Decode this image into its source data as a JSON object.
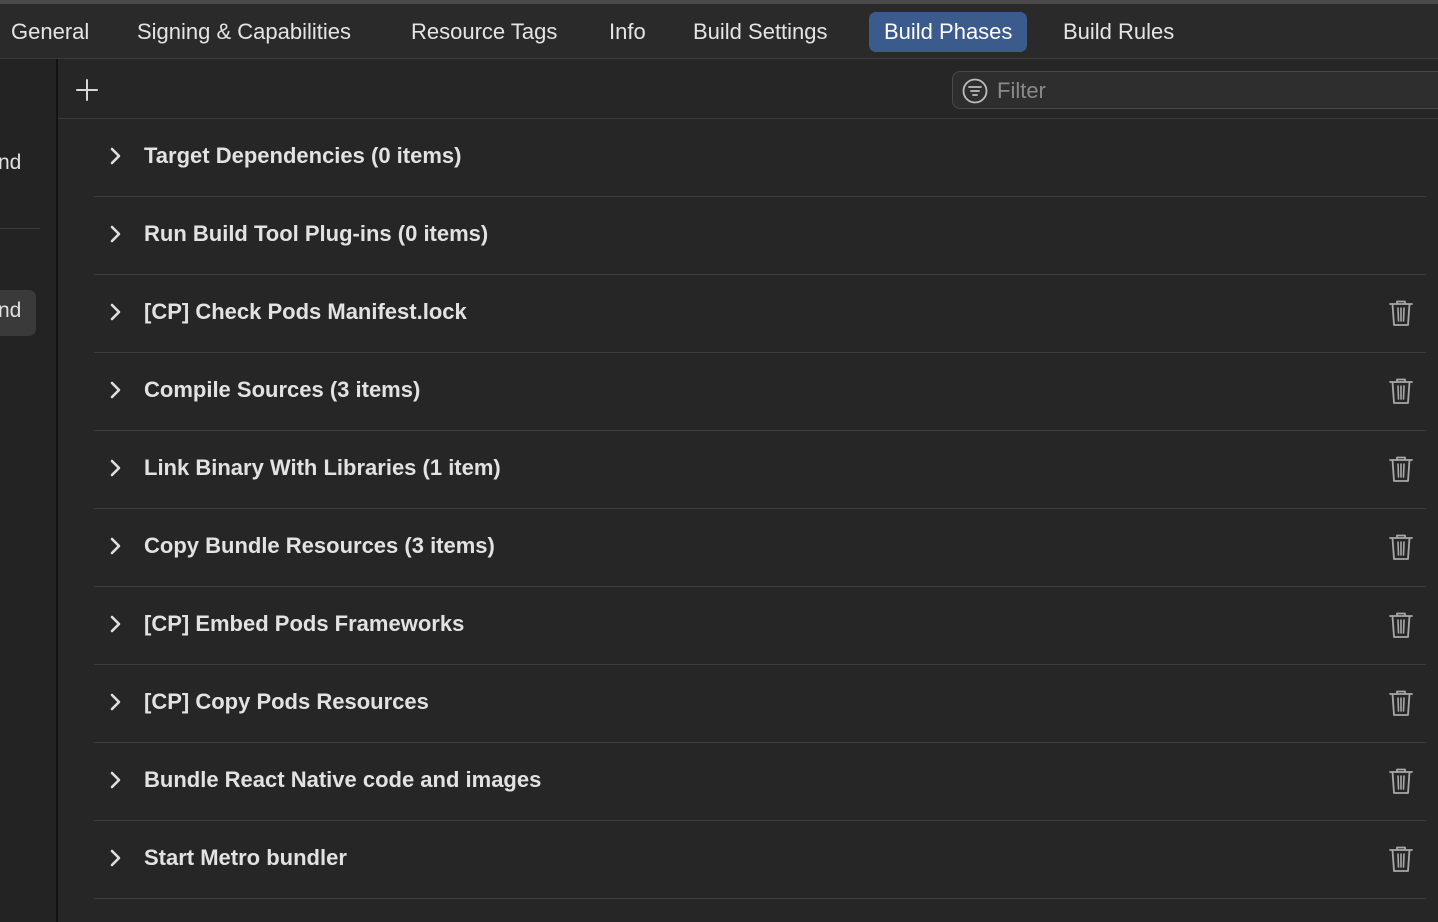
{
  "tabs": [
    {
      "label": "General",
      "active": false
    },
    {
      "label": "Signing & Capabilities",
      "active": false
    },
    {
      "label": "Resource Tags",
      "active": false
    },
    {
      "label": "Info",
      "active": false
    },
    {
      "label": "Build Settings",
      "active": false
    },
    {
      "label": "Build Phases",
      "active": true
    },
    {
      "label": "Build Rules",
      "active": false
    }
  ],
  "sidebar": {
    "items": [
      {
        "label": "nd",
        "selected": false
      },
      {
        "label": "nd",
        "selected": true
      }
    ]
  },
  "toolbar": {
    "add_icon": "plus-icon",
    "filter_placeholder": "Filter",
    "filter_value": "",
    "filter_icon": "filter-circle-icon"
  },
  "phases": [
    {
      "title": "Target Dependencies (0 items)",
      "deletable": false
    },
    {
      "title": "Run Build Tool Plug-ins (0 items)",
      "deletable": false
    },
    {
      "title": "[CP] Check Pods Manifest.lock",
      "deletable": true
    },
    {
      "title": "Compile Sources (3 items)",
      "deletable": true
    },
    {
      "title": "Link Binary With Libraries (1 item)",
      "deletable": true
    },
    {
      "title": "Copy Bundle Resources (3 items)",
      "deletable": true
    },
    {
      "title": "[CP] Embed Pods Frameworks",
      "deletable": true
    },
    {
      "title": "[CP] Copy Pods Resources",
      "deletable": true
    },
    {
      "title": "Bundle React Native code and images",
      "deletable": true
    },
    {
      "title": "Start Metro bundler",
      "deletable": true
    }
  ],
  "colors": {
    "accent": "#3b5b8c",
    "background": "#262626",
    "text": "#e2e2e2"
  }
}
